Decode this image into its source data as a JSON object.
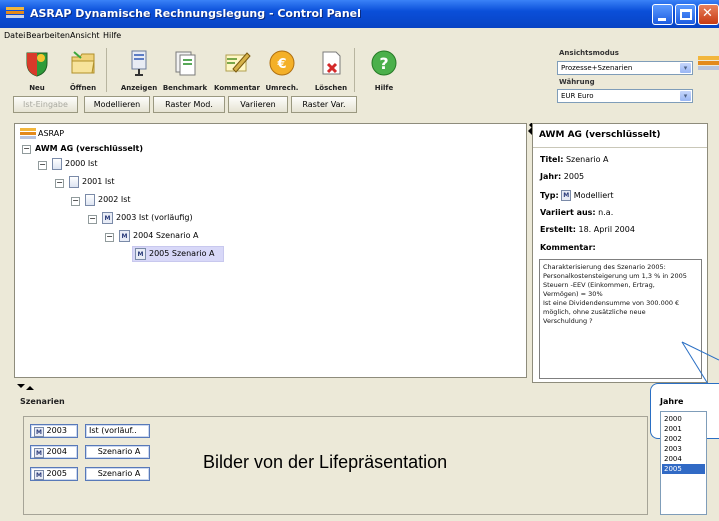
{
  "window": {
    "title": "ASRAP Dynamische Rechnungslegung - Control Panel"
  },
  "menu": [
    "Datei",
    "Bearbeiten",
    "Ansicht",
    "Hilfe"
  ],
  "toolbar": {
    "buttons": [
      {
        "label": "Neu",
        "icon": "new-shield-icon"
      },
      {
        "label": "Öffnen",
        "icon": "open-folder-icon"
      },
      {
        "label": "Anzeigen",
        "icon": "display-icon"
      },
      {
        "label": "Benchmark",
        "icon": "benchmark-icon"
      },
      {
        "label": "Kommentar",
        "icon": "comment-pencil-icon"
      },
      {
        "label": "Umrech.",
        "icon": "currency-convert-icon"
      },
      {
        "label": "Löschen",
        "icon": "delete-icon"
      },
      {
        "label": "Hilfe",
        "icon": "help-icon"
      }
    ],
    "mode_buttons": [
      "Ist-Eingabe",
      "Modellieren",
      "Raster Mod.",
      "Variieren",
      "Raster Var."
    ]
  },
  "view_settings": {
    "mode_label": "Ansichtsmodus",
    "mode_value": "Prozesse+Szenarien",
    "currency_label": "Währung",
    "currency_value": "EUR Euro"
  },
  "tree": {
    "root": "ASRAP",
    "company": "AWM AG (verschlüsselt)",
    "nodes": [
      "2000 Ist",
      "2001 Ist",
      "2002 Ist",
      "2003 Ist (vorläufig)",
      "2004 Szenario A",
      "2005 Szenario A"
    ]
  },
  "info": {
    "header": "AWM AG (verschlüsselt)",
    "titel_label": "Titel:",
    "titel_value": "Szenario A",
    "jahr_label": "Jahr:",
    "jahr_value": "2005",
    "typ_label": "Typ:",
    "typ_value": "Modelliert",
    "typ_badge": "M",
    "variiert_label": "Variiert aus:",
    "variiert_value": "n.a.",
    "erstellt_label": "Erstellt:",
    "erstellt_value": "18. April 2004",
    "kommentar_label": "Kommentar:",
    "kommentar_text": "Charakterisierung des Szenario 2005:\nPersonalkostensteigerung um 1,3 % in 2005\nSteuern -EEV (Einkommen, Ertrag,\nVermögen) = 30%\nIst eine Dividendensumme von 300.000 €\nmöglich, ohne zusätzliche neue\nVerschuldung ?"
  },
  "szenarien": {
    "title": "Szenarien",
    "rows": [
      {
        "year": "2003",
        "name": "Ist (vorläuf..",
        "badge": "M"
      },
      {
        "year": "2004",
        "name": "Szenario A",
        "badge": "M"
      },
      {
        "year": "2005",
        "name": "Szenario A",
        "badge": "M"
      }
    ]
  },
  "caption": "Bilder von der Lifepräsentation",
  "jahre": {
    "title": "Jahre",
    "items": [
      "2000",
      "2001",
      "2002",
      "2003",
      "2004",
      "2005"
    ],
    "selected": "2005"
  },
  "colors": {
    "titlebar": "#0a4fd9",
    "selection": "#316ac5",
    "window_bg": "#ece9d8"
  }
}
